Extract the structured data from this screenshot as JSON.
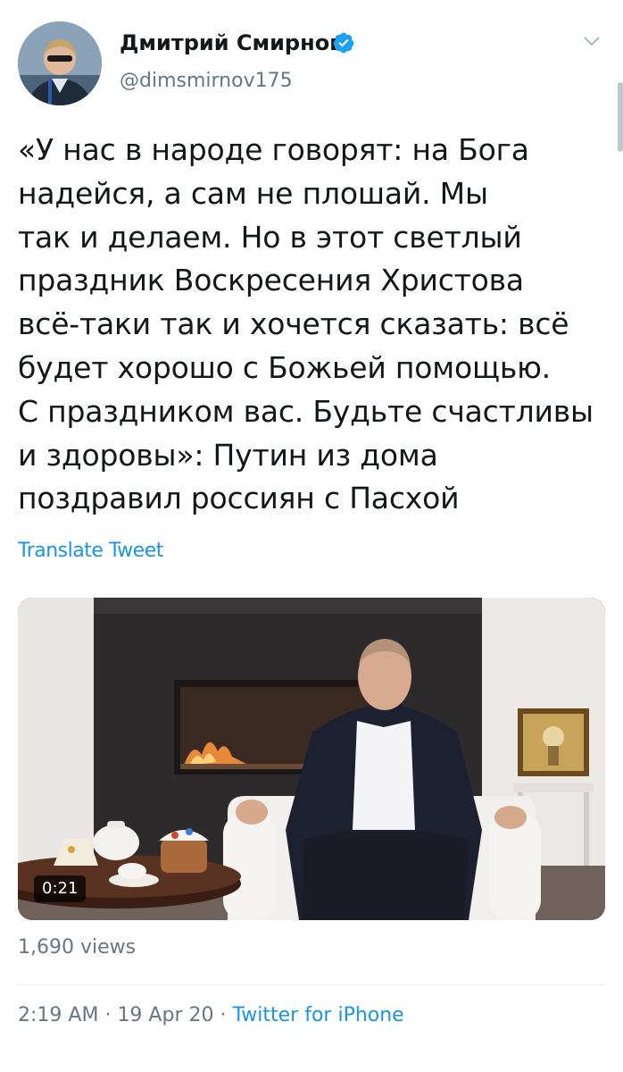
{
  "tweet": {
    "author": {
      "display_name": "Дмитрий Смирнов",
      "handle": "@dimsmirnov175",
      "verified": true
    },
    "text_lines": [
      "«У нас в народе говорят: на Бога",
      "надейся, а сам не плошай. Мы",
      "так и делаем. Но в этот светлый",
      "праздник Воскресения Христова",
      "всё-таки так и хочется сказать: всё",
      "будет хорошо с Божьей помощью.",
      "С праздником вас. Будьте счастливы",
      "и здоровы»: Путин из дома",
      "поздравил россиян с Пасхой"
    ],
    "translate_label": "Translate Tweet",
    "video": {
      "duration": "0:21"
    },
    "views": "1,690 views",
    "time": "2:19 AM",
    "separator": "·",
    "date": "19 Apr 20",
    "source": "Twitter for iPhone"
  },
  "colors": {
    "link_blue": "#1b95e0",
    "secondary_text": "#657786",
    "primary_text": "#14171a"
  }
}
